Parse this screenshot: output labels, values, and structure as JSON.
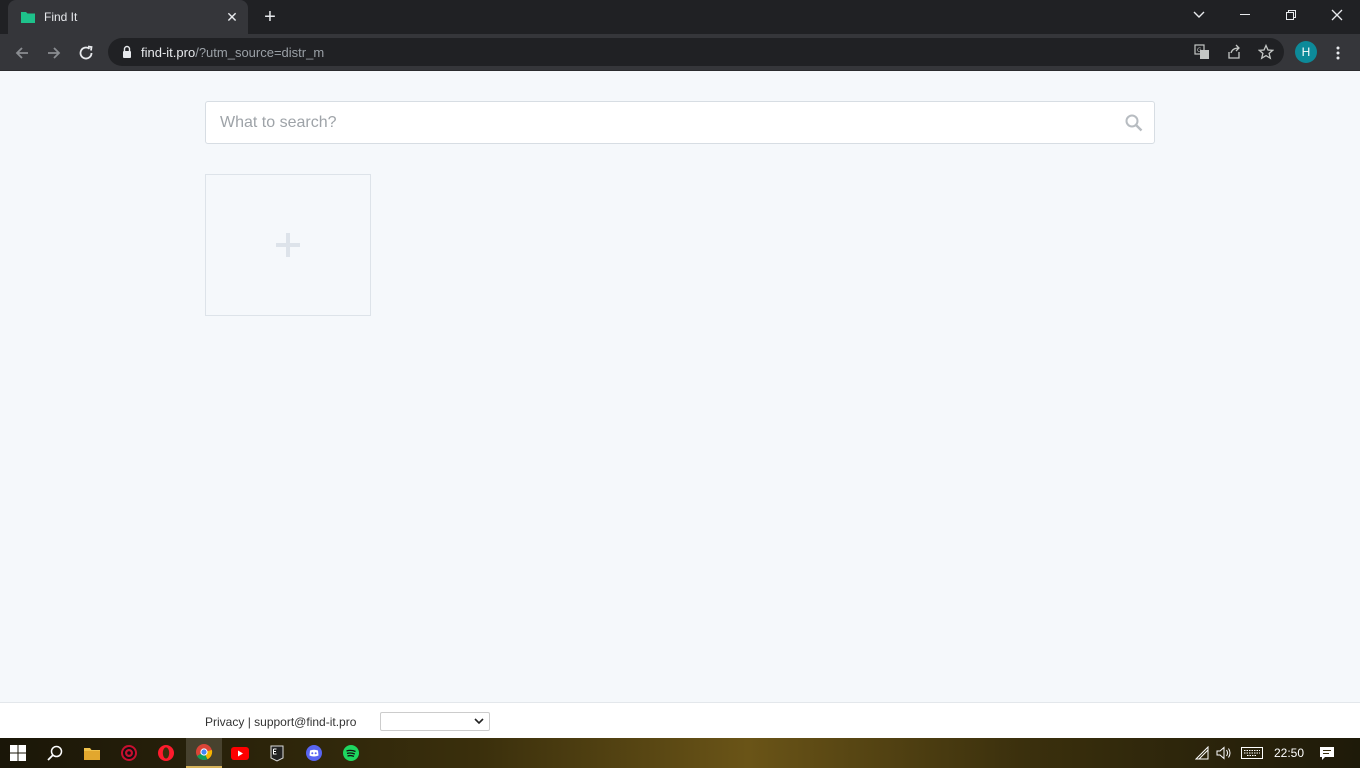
{
  "browser": {
    "tab": {
      "title": "Find It",
      "favicon_color": "#1ec28b"
    },
    "url": {
      "host": "find-it.pro",
      "path": "/?utm_source=distr_m"
    },
    "profile_initial": "H",
    "profile_color": "#0d8a99"
  },
  "page": {
    "search": {
      "placeholder": "What to search?"
    },
    "add_tile": {
      "icon": "plus-icon"
    }
  },
  "footer": {
    "privacy_label": "Privacy",
    "separator": "|",
    "support_email": "support@find-it.pro",
    "language_selected": ""
  },
  "taskbar": {
    "apps": [
      "windows-start-icon",
      "search-icon",
      "file-explorer-icon",
      "app-icon",
      "opera-icon",
      "chrome-icon",
      "youtube-icon",
      "epic-games-icon",
      "discord-icon",
      "spotify-icon"
    ],
    "clock": "22:50"
  }
}
